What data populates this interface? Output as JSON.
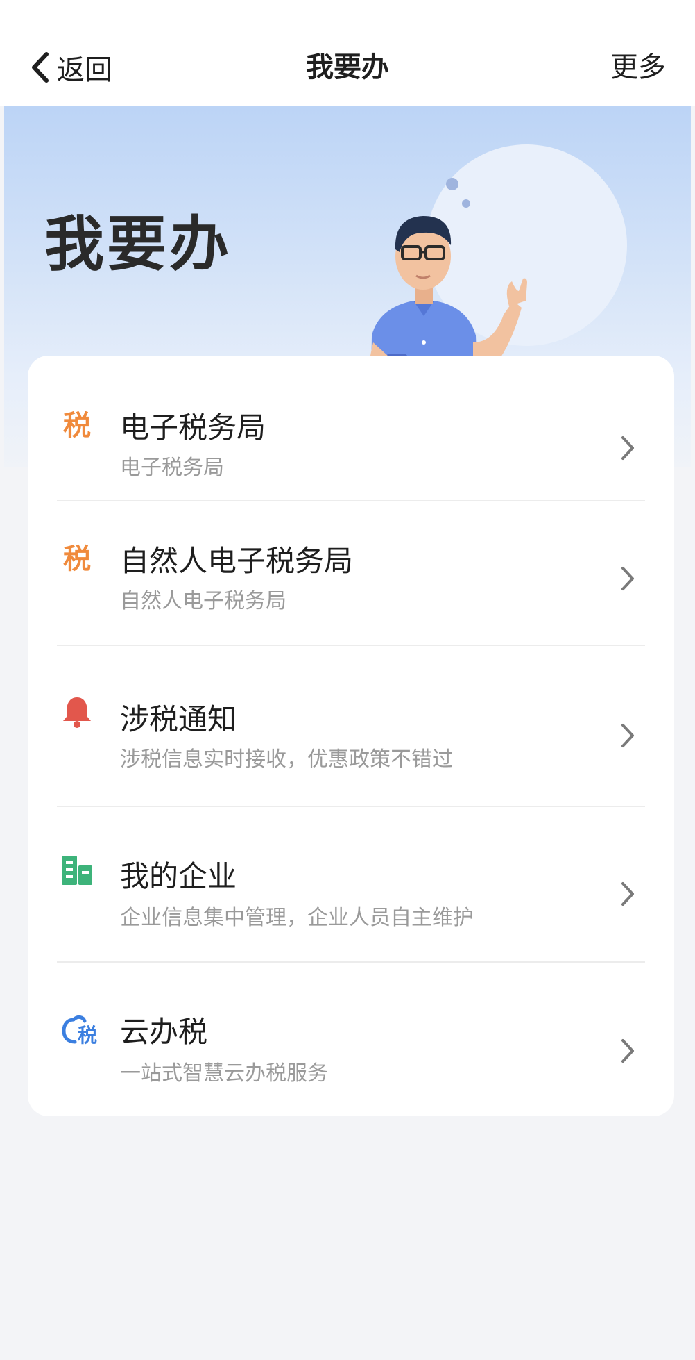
{
  "nav": {
    "back_label": "返回",
    "title": "我要办",
    "more_label": "更多"
  },
  "hero": {
    "title": "我要办"
  },
  "items": [
    {
      "label": "电子税务局",
      "subtitle": "电子税务局",
      "icon": "tax-icon",
      "icon_color": "#f08a3c"
    },
    {
      "label": "自然人电子税务局",
      "subtitle": "自然人电子税务局",
      "icon": "tax-icon",
      "icon_color": "#f08a3c"
    },
    {
      "label": "涉税通知",
      "subtitle": "涉税信息实时接收，优惠政策不错过",
      "icon": "bell-icon",
      "icon_color": "#e2574c"
    },
    {
      "label": "我的企业",
      "subtitle": "企业信息集中管理，企业人员自主维护",
      "icon": "building-icon",
      "icon_color": "#3db37a"
    },
    {
      "label": "云办税",
      "subtitle": "一站式智慧云办税服务",
      "icon": "cloud-tax-icon",
      "icon_color": "#3b7fe0"
    }
  ],
  "icon_glyphs": {
    "tax": "税",
    "cloud_tax": "税"
  }
}
